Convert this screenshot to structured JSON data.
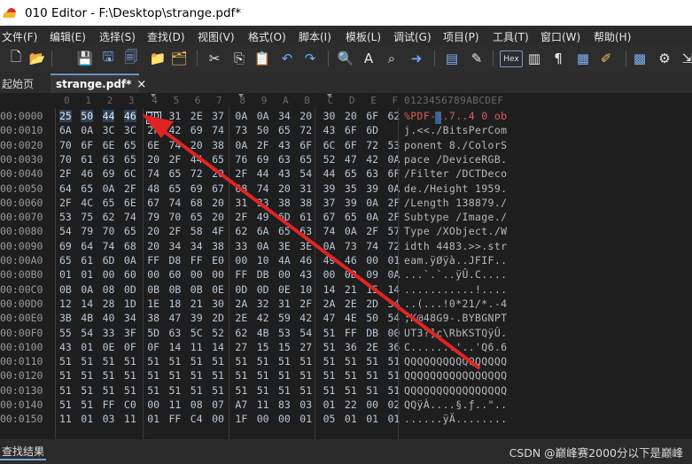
{
  "window": {
    "title": "010 Editor - F:\\Desktop\\strange.pdf*"
  },
  "menu": [
    "文件(F)",
    "编辑(E)",
    "选择(S)",
    "查找(D)",
    "视图(V)",
    "格式(O)",
    "脚本(I)",
    "模板(L)",
    "调试(G)",
    "项目(P)",
    "工具(T)",
    "窗口(W)",
    "帮助(H)"
  ],
  "toolbar": {
    "icons": [
      "new-file-icon",
      "open-folder-icon",
      "save-icon",
      "save-as-icon",
      "save-all-icon",
      "open-folder-2-icon",
      "open-multiple-icon",
      "cut-icon",
      "copy-icon",
      "paste-icon",
      "undo-icon",
      "redo-icon",
      "find-icon",
      "replace-icon",
      "find-in-files-icon",
      "goto-icon",
      "template-icon",
      "script-icon",
      "hex-toggle-icon",
      "column-mode-icon",
      "pilcrow-icon",
      "columns-icon",
      "highlight-icon",
      "calculator-icon",
      "settings-icon",
      "collapse-icon"
    ],
    "hex_label": "Hex"
  },
  "tabs": {
    "start_label": "起始页",
    "active_label": "strange.pdf*",
    "close_glyph": "×"
  },
  "hex": {
    "col_headers": [
      "0",
      "1",
      "2",
      "3",
      "4",
      "5",
      "6",
      "7",
      "8",
      "9",
      "A",
      "B",
      "C",
      "D",
      "E",
      "F"
    ],
    "ascii_header": "0123456789ABCDEF",
    "rows": [
      {
        "addr": "00:0000",
        "bytes": [
          "25",
          "50",
          "44",
          "46",
          "2D",
          "31",
          "2E",
          "37",
          "0A",
          "0A",
          "34",
          "20",
          "30",
          "20",
          "6F",
          "62"
        ],
        "ascii": "%PDF-1.7..4 0 ob"
      },
      {
        "addr": "00:0010",
        "bytes": [
          "6A",
          "0A",
          "3C",
          "3C",
          "2F",
          "42",
          "69",
          "74",
          "73",
          "50",
          "65",
          "72",
          "43",
          "6F",
          "6D"
        ],
        "ascii": "j.<<./BitsPerCom"
      },
      {
        "addr": "00:0020",
        "bytes": [
          "70",
          "6F",
          "6E",
          "65",
          "6E",
          "74",
          "20",
          "38",
          "0A",
          "2F",
          "43",
          "6F",
          "6C",
          "6F",
          "72",
          "53"
        ],
        "ascii": "ponent 8./ColorS"
      },
      {
        "addr": "00:0030",
        "bytes": [
          "70",
          "61",
          "63",
          "65",
          "20",
          "2F",
          "44",
          "65",
          "76",
          "69",
          "63",
          "65",
          "52",
          "47",
          "42",
          "0A"
        ],
        "ascii": "pace /DeviceRGB."
      },
      {
        "addr": "00:0040",
        "bytes": [
          "2F",
          "46",
          "69",
          "6C",
          "74",
          "65",
          "72",
          "20",
          "2F",
          "44",
          "43",
          "54",
          "44",
          "65",
          "63",
          "6F"
        ],
        "ascii": "/Filter /DCTDeco"
      },
      {
        "addr": "00:0050",
        "bytes": [
          "64",
          "65",
          "0A",
          "2F",
          "48",
          "65",
          "69",
          "67",
          "68",
          "74",
          "20",
          "31",
          "39",
          "35",
          "39",
          "0A"
        ],
        "ascii": "de./Height 1959."
      },
      {
        "addr": "00:0060",
        "bytes": [
          "2F",
          "4C",
          "65",
          "6E",
          "67",
          "74",
          "68",
          "20",
          "31",
          "33",
          "38",
          "38",
          "37",
          "39",
          "0A",
          "2F"
        ],
        "ascii": "/Length 138879./"
      },
      {
        "addr": "00:0070",
        "bytes": [
          "53",
          "75",
          "62",
          "74",
          "79",
          "70",
          "65",
          "20",
          "2F",
          "49",
          "6D",
          "61",
          "67",
          "65",
          "0A",
          "2F"
        ],
        "ascii": "Subtype /Image./"
      },
      {
        "addr": "00:0080",
        "bytes": [
          "54",
          "79",
          "70",
          "65",
          "20",
          "2F",
          "58",
          "4F",
          "62",
          "6A",
          "65",
          "63",
          "74",
          "0A",
          "2F",
          "57"
        ],
        "ascii": "Type /XObject./W"
      },
      {
        "addr": "00:0090",
        "bytes": [
          "69",
          "64",
          "74",
          "68",
          "20",
          "34",
          "34",
          "38",
          "33",
          "0A",
          "3E",
          "3E",
          "0A",
          "73",
          "74",
          "72"
        ],
        "ascii": "idth 4483.>>.str"
      },
      {
        "addr": "00:00A0",
        "bytes": [
          "65",
          "61",
          "6D",
          "0A",
          "FF",
          "D8",
          "FF",
          "E0",
          "00",
          "10",
          "4A",
          "46",
          "49",
          "46",
          "00",
          "01"
        ],
        "ascii": "eam.ÿØÿà..JFIF.."
      },
      {
        "addr": "00:00B0",
        "bytes": [
          "01",
          "01",
          "00",
          "60",
          "00",
          "60",
          "00",
          "00",
          "FF",
          "DB",
          "00",
          "43",
          "00",
          "0D",
          "09",
          "0A"
        ],
        "ascii": "...`.`..ÿÛ.C...."
      },
      {
        "addr": "00:00C0",
        "bytes": [
          "0B",
          "0A",
          "08",
          "0D",
          "0B",
          "0B",
          "0B",
          "0E",
          "0D",
          "0D",
          "0E",
          "10",
          "14",
          "21",
          "15",
          "14",
          "12"
        ],
        "ascii": "...........!...."
      },
      {
        "addr": "00:00D0",
        "bytes": [
          "12",
          "14",
          "28",
          "1D",
          "1E",
          "18",
          "21",
          "30",
          "2A",
          "32",
          "31",
          "2F",
          "2A",
          "2E",
          "2D",
          "34"
        ],
        "ascii": "..(...!0*21/*.-4"
      },
      {
        "addr": "00:00E0",
        "bytes": [
          "3B",
          "4B",
          "40",
          "34",
          "38",
          "47",
          "39",
          "2D",
          "2E",
          "42",
          "59",
          "42",
          "47",
          "4E",
          "50",
          "54"
        ],
        "ascii": ";K@48G9-.BYBGNPT"
      },
      {
        "addr": "00:00F0",
        "bytes": [
          "55",
          "54",
          "33",
          "3F",
          "5D",
          "63",
          "5C",
          "52",
          "62",
          "4B",
          "53",
          "54",
          "51",
          "FF",
          "DB",
          "00"
        ],
        "ascii": "UT3?]c\\RbKSTQÿÛ."
      },
      {
        "addr": "00:0100",
        "bytes": [
          "43",
          "01",
          "0E",
          "0F",
          "0F",
          "14",
          "11",
          "14",
          "27",
          "15",
          "15",
          "27",
          "51",
          "36",
          "2E",
          "36"
        ],
        "ascii": "C.......'..'Q6.6"
      },
      {
        "addr": "00:0110",
        "bytes": [
          "51",
          "51",
          "51",
          "51",
          "51",
          "51",
          "51",
          "51",
          "51",
          "51",
          "51",
          "51",
          "51",
          "51",
          "51",
          "51"
        ],
        "ascii": "QQQQQQQQQQQQQQQQ"
      },
      {
        "addr": "00:0120",
        "bytes": [
          "51",
          "51",
          "51",
          "51",
          "51",
          "51",
          "51",
          "51",
          "51",
          "51",
          "51",
          "51",
          "51",
          "51",
          "51",
          "51"
        ],
        "ascii": "QQQQQQQQQQQQQQQQ"
      },
      {
        "addr": "00:0130",
        "bytes": [
          "51",
          "51",
          "51",
          "51",
          "51",
          "51",
          "51",
          "51",
          "51",
          "51",
          "51",
          "51",
          "51",
          "51",
          "51",
          "51"
        ],
        "ascii": "QQQQQQQQQQQQQQQQ"
      },
      {
        "addr": "00:0140",
        "bytes": [
          "51",
          "51",
          "FF",
          "C0",
          "00",
          "11",
          "08",
          "07",
          "A7",
          "11",
          "83",
          "03",
          "01",
          "22",
          "00",
          "02"
        ],
        "ascii": "QQÿÀ....§.ƒ..\".."
      },
      {
        "addr": "00:0150",
        "bytes": [
          "11",
          "01",
          "03",
          "11",
          "01",
          "FF",
          "C4",
          "00",
          "1F",
          "00",
          "00",
          "01",
          "05",
          "01",
          "01",
          "01"
        ],
        "ascii": "......ÿÄ........"
      }
    ]
  },
  "status": {
    "find_results_label": "查找结果",
    "watermark": "CSDN @巅峰赛2000分以下是巅峰"
  },
  "colors": {
    "arrow": "#e02424",
    "menu_bg": "#2b2b2b",
    "hex_bg": "#1e1e1e",
    "highlight": "#2f4256"
  }
}
